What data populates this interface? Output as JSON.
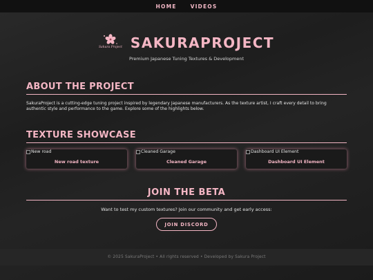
{
  "nav": {
    "items": [
      {
        "label": "HOME"
      },
      {
        "label": "VIDEOS"
      }
    ]
  },
  "hero": {
    "logo_script": "Sakura Project",
    "title": "SAKURAPROJECT",
    "tagline": "Premium Japanese Tuning Textures & Development"
  },
  "about": {
    "heading": "ABOUT THE PROJECT",
    "text": "SakuraProject is a cutting-edge tuning project inspired by legendary Japanese manufacturers. As the texture artist, I craft every detail to bring authentic style and performance to the game. Explore some of the highlights below."
  },
  "showcase": {
    "heading": "TEXTURE SHOWCASE",
    "cards": [
      {
        "img_alt": "New road",
        "title": "New road texture"
      },
      {
        "img_alt": "Cleaned Garage",
        "title": "Cleaned Garage"
      },
      {
        "img_alt": "Dashboard UI Element",
        "title": "Dashboard UI Element"
      }
    ]
  },
  "beta": {
    "heading": "JOIN THE BETA",
    "text": "Want to test my custom textures? Join our community and get early access:",
    "button_label": "JOIN DISCORD"
  },
  "footer": {
    "text": "© 2025 SakuraProject • All rights reserved • Developed by Sakura Project"
  },
  "colors": {
    "accent_pink": "#f4b6c4",
    "background": "#1e1e1e",
    "nav_bg": "#111111",
    "footer_bg": "#262626"
  },
  "icons": {
    "logo": "sakura-flower-icon",
    "broken_image": "broken-image-icon"
  }
}
